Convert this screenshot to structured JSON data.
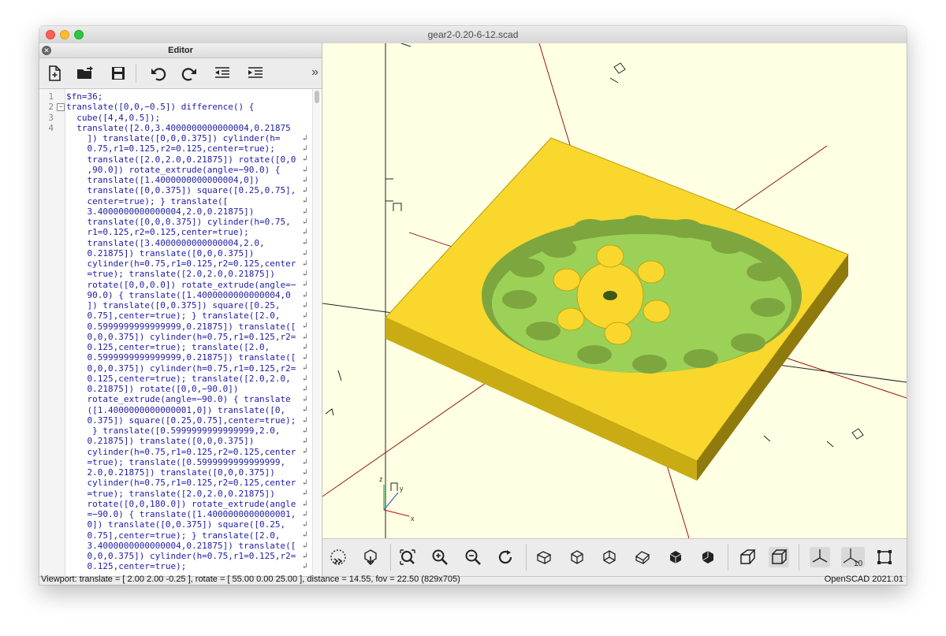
{
  "window": {
    "title": "gear2-0.20-6-12.scad"
  },
  "editor": {
    "title": "Editor",
    "close_icon": "close-icon",
    "toolbar": [
      "new-file-icon",
      "open-folder-icon",
      "save-icon",
      "undo-icon",
      "redo-icon",
      "unindent-icon",
      "indent-icon",
      "more-chevron-icon"
    ],
    "more_chevron": "»",
    "line_numbers": [
      "1",
      "2",
      "3",
      "4"
    ],
    "code_lines": [
      {
        "n": "1",
        "text": "$fn=36;"
      },
      {
        "n": "2",
        "fold": "−",
        "text": "translate([0,0,−0.5]) difference() {"
      },
      {
        "n": "3",
        "text": "  cube([4,4,0.5]);"
      },
      {
        "n": "4",
        "text": "  translate([2.0,3.4000000000000004,0.21875",
        "wrap": true
      },
      {
        "text": "    ]) translate([0,0,0.375]) cylinder(h=",
        "wrap": true
      },
      {
        "text": "    0.75,r1=0.125,r2=0.125,center=true);",
        "wrap": true
      },
      {
        "text": "    translate([2.0,2.0,0.21875]) rotate([0,0",
        "wrap": true
      },
      {
        "text": "    ,90.0]) rotate_extrude(angle=−90.0) {",
        "wrap": true
      },
      {
        "text": "    translate([1.4000000000000004,0])",
        "wrap": true
      },
      {
        "text": "    translate([0,0.375]) square([0.25,0.75],",
        "wrap": true
      },
      {
        "text": "    center=true); } translate([",
        "wrap": true
      },
      {
        "text": "    3.4000000000000004,2.0,0.21875])",
        "wrap": true
      },
      {
        "text": "    translate([0,0,0.375]) cylinder(h=0.75,",
        "wrap": true
      },
      {
        "text": "    r1=0.125,r2=0.125,center=true);",
        "wrap": true
      },
      {
        "text": "    translate([3.4000000000000004,2.0,",
        "wrap": true
      },
      {
        "text": "    0.21875]) translate([0,0,0.375])",
        "wrap": true
      },
      {
        "text": "    cylinder(h=0.75,r1=0.125,r2=0.125,center",
        "wrap": true
      },
      {
        "text": "    =true); translate([2.0,2.0,0.21875])",
        "wrap": true
      },
      {
        "text": "    rotate([0,0,0.0]) rotate_extrude(angle=−",
        "wrap": true
      },
      {
        "text": "    90.0) { translate([1.4000000000000004,0",
        "wrap": true
      },
      {
        "text": "    ]) translate([0,0.375]) square([0.25,",
        "wrap": true
      },
      {
        "text": "    0.75],center=true); } translate([2.0,",
        "wrap": true
      },
      {
        "text": "    0.5999999999999999,0.21875]) translate([",
        "wrap": true
      },
      {
        "text": "    0,0,0.375]) cylinder(h=0.75,r1=0.125,r2=",
        "wrap": true
      },
      {
        "text": "    0.125,center=true); translate([2.0,",
        "wrap": true
      },
      {
        "text": "    0.5999999999999999,0.21875]) translate([",
        "wrap": true
      },
      {
        "text": "    0,0,0.375]) cylinder(h=0.75,r1=0.125,r2=",
        "wrap": true
      },
      {
        "text": "    0.125,center=true); translate([2.0,2.0,",
        "wrap": true
      },
      {
        "text": "    0.21875]) rotate([0,0,−90.0])",
        "wrap": true
      },
      {
        "text": "    rotate_extrude(angle=−90.0) { translate",
        "wrap": true
      },
      {
        "text": "    ([1.4000000000000001,0]) translate([0,",
        "wrap": true
      },
      {
        "text": "    0.375]) square([0.25,0.75],center=true);",
        "wrap": true
      },
      {
        "text": "     } translate([0.5999999999999999,2.0,",
        "wrap": true
      },
      {
        "text": "    0.21875]) translate([0,0,0.375])",
        "wrap": true
      },
      {
        "text": "    cylinder(h=0.75,r1=0.125,r2=0.125,center",
        "wrap": true
      },
      {
        "text": "    =true); translate([0.5999999999999999,",
        "wrap": true
      },
      {
        "text": "    2.0,0.21875]) translate([0,0,0.375])",
        "wrap": true
      },
      {
        "text": "    cylinder(h=0.75,r1=0.125,r2=0.125,center",
        "wrap": true
      },
      {
        "text": "    =true); translate([2.0,2.0,0.21875])",
        "wrap": true
      },
      {
        "text": "    rotate([0,0,180.0]) rotate_extrude(angle",
        "wrap": true
      },
      {
        "text": "    =−90.0) { translate([1.4000000000000001,",
        "wrap": true
      },
      {
        "text": "    0]) translate([0,0.375]) square([0.25,",
        "wrap": true
      },
      {
        "text": "    0.75],center=true); } translate([2.0,",
        "wrap": true
      },
      {
        "text": "    3.4000000000000004,0.21875]) translate([",
        "wrap": true
      },
      {
        "text": "    0,0,0.375]) cylinder(h=0.75,r1=0.125,r2=",
        "wrap": true
      },
      {
        "text": "    0.125,center=true);",
        "wrap": false
      }
    ],
    "wrap_glyph": "↲"
  },
  "viewport": {
    "axis_label_z": "z",
    "axis_label_x": "x",
    "axis_label_y": "y",
    "colors": {
      "background": "#ffffe4",
      "model": "#f9d72c",
      "cutout": "#9cd157",
      "axis": "#8b0000",
      "grid": "#222222"
    }
  },
  "view_toolbar": [
    "preview-render-icon",
    "export-render-icon",
    "view-all-icon",
    "zoom-in-icon",
    "zoom-out-icon",
    "reset-view-icon",
    "view-right-icon",
    "view-top-icon",
    "view-bottom-icon",
    "view-left-icon",
    "view-front-icon",
    "view-back-icon",
    "perspective-icon",
    "orthogonal-icon",
    "show-axes-icon",
    "show-scale-icon",
    "show-edges-icon"
  ],
  "scale_label": "10",
  "status": {
    "left": "Viewport: translate = [ 2.00 2.00 -0.25 ], rotate = [ 55.00 0.00 25.00 ], distance = 14.55, fov = 22.50 (829x705)",
    "right": "OpenSCAD 2021.01"
  }
}
